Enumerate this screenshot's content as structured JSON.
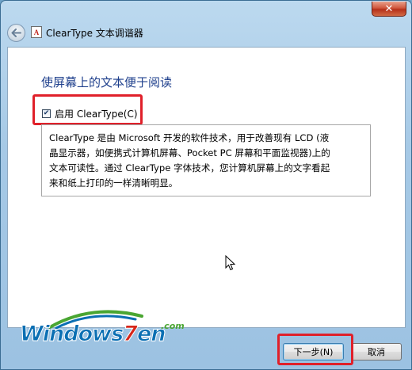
{
  "window": {
    "title": "ClearType 文本调谐器",
    "app_icon_glyph": "A",
    "close_glyph": "✕"
  },
  "main": {
    "heading": "使屏幕上的文本便于阅读",
    "checkbox": {
      "label": "启用 ClearType(C)",
      "checked": true
    },
    "description_lines": [
      "ClearType 是由 Microsoft 开发的软件技术，用于改善现有 LCD (液",
      "晶显示器，如便携式计算机屏幕、Pocket PC 屏幕和平面监视器)上的",
      "文本可读性。通过 ClearType 字体技术，您计算机屏幕上的文字看起",
      "来和纸上打印的一样清晰明显。"
    ]
  },
  "watermark": {
    "logo": "Windows",
    "logo_seven": "7",
    "logo_en": "en",
    "dot_com": ".com"
  },
  "buttons": {
    "next": "下一步(N)",
    "cancel": "取消"
  },
  "colors": {
    "heading": "#1e3f8c",
    "highlight": "#e0202a",
    "brand_blue": "#0b6fb3",
    "brand_red": "#d6261a",
    "brand_green": "#4aa632"
  },
  "icons": [
    "back-arrow-icon",
    "app-icon",
    "close-icon",
    "mouse-cursor-icon"
  ]
}
